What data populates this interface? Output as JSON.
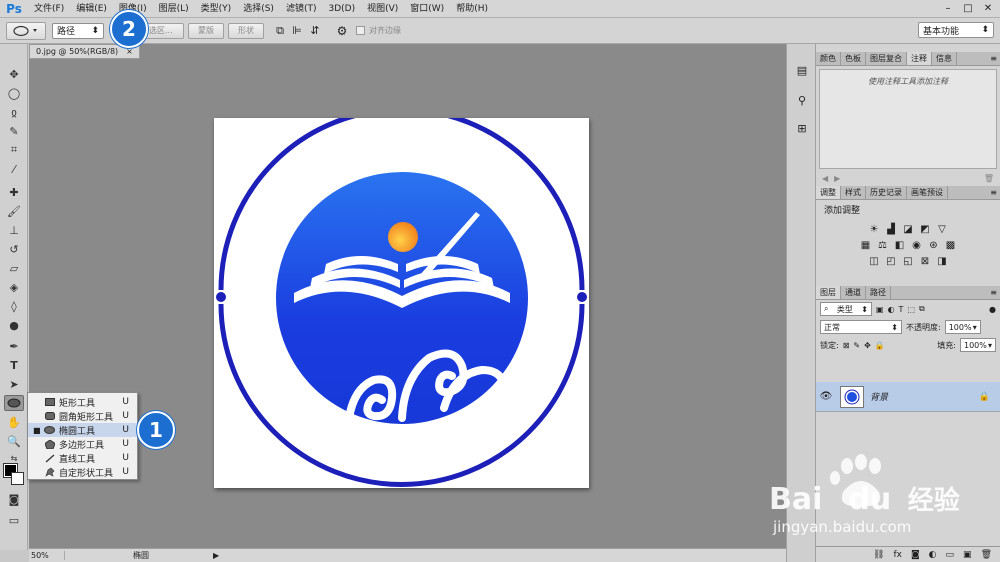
{
  "app": {
    "logo": "Ps"
  },
  "menu": [
    "文件(F)",
    "编辑(E)",
    "图像(I)",
    "图层(L)",
    "类型(Y)",
    "选择(S)",
    "滤镜(T)",
    "3D(D)",
    "视图(V)",
    "窗口(W)",
    "帮助(H)"
  ],
  "window_controls": [
    "–",
    "□",
    "✕"
  ],
  "options": {
    "mode_value": "路径",
    "selection_btn": "选区...",
    "mask_btn": "蒙版",
    "shape_btn": "形状",
    "align_edges_label": "对齐边缘",
    "workspace_value": "基本功能"
  },
  "document": {
    "tab_title": "0.jpg @ 50%(RGB/8)",
    "tab_close": "×"
  },
  "flyout": {
    "items": [
      {
        "label": "矩形工具",
        "key": "U",
        "icon": "rectangle-icon",
        "selected": false
      },
      {
        "label": "圆角矩形工具",
        "key": "U",
        "icon": "rounded-rectangle-icon",
        "selected": false
      },
      {
        "label": "椭圆工具",
        "key": "U",
        "icon": "ellipse-icon",
        "selected": true
      },
      {
        "label": "多边形工具",
        "key": "U",
        "icon": "polygon-icon",
        "selected": false
      },
      {
        "label": "直线工具",
        "key": "U",
        "icon": "line-icon",
        "selected": false
      },
      {
        "label": "自定形状工具",
        "key": "U",
        "icon": "custom-shape-icon",
        "selected": false
      }
    ]
  },
  "markers": {
    "one": "1",
    "two": "2"
  },
  "status": {
    "zoom": "50%",
    "tool_name": "椭圆"
  },
  "panels": {
    "top_tabs": [
      "颜色",
      "色板",
      "图层复合",
      "注释",
      "信息"
    ],
    "top_active": 3,
    "notes_placeholder": "使用注释工具添加注释",
    "adj_tabs": [
      "调整",
      "样式",
      "历史记录",
      "画笔预设"
    ],
    "adj_active": 0,
    "adj_title": "添加调整",
    "layer_tabs": [
      "图层",
      "通道",
      "路径"
    ],
    "layer_active": 0,
    "filter_kind": "类型",
    "blend_mode": "正常",
    "opacity_label": "不透明度:",
    "opacity_value": "100%",
    "lock_label": "锁定:",
    "fill_label": "填充:",
    "fill_value": "100%",
    "layer_name": "背景"
  },
  "watermark": {
    "brand": "Bai",
    "brand2": "du",
    "cn": "经验",
    "url": "jingyan.baidu.com"
  },
  "colors": {
    "accent_blue": "#1c3fd6",
    "marker_blue": "#1c6fd0",
    "layer_highlight": "#b8cce8"
  }
}
